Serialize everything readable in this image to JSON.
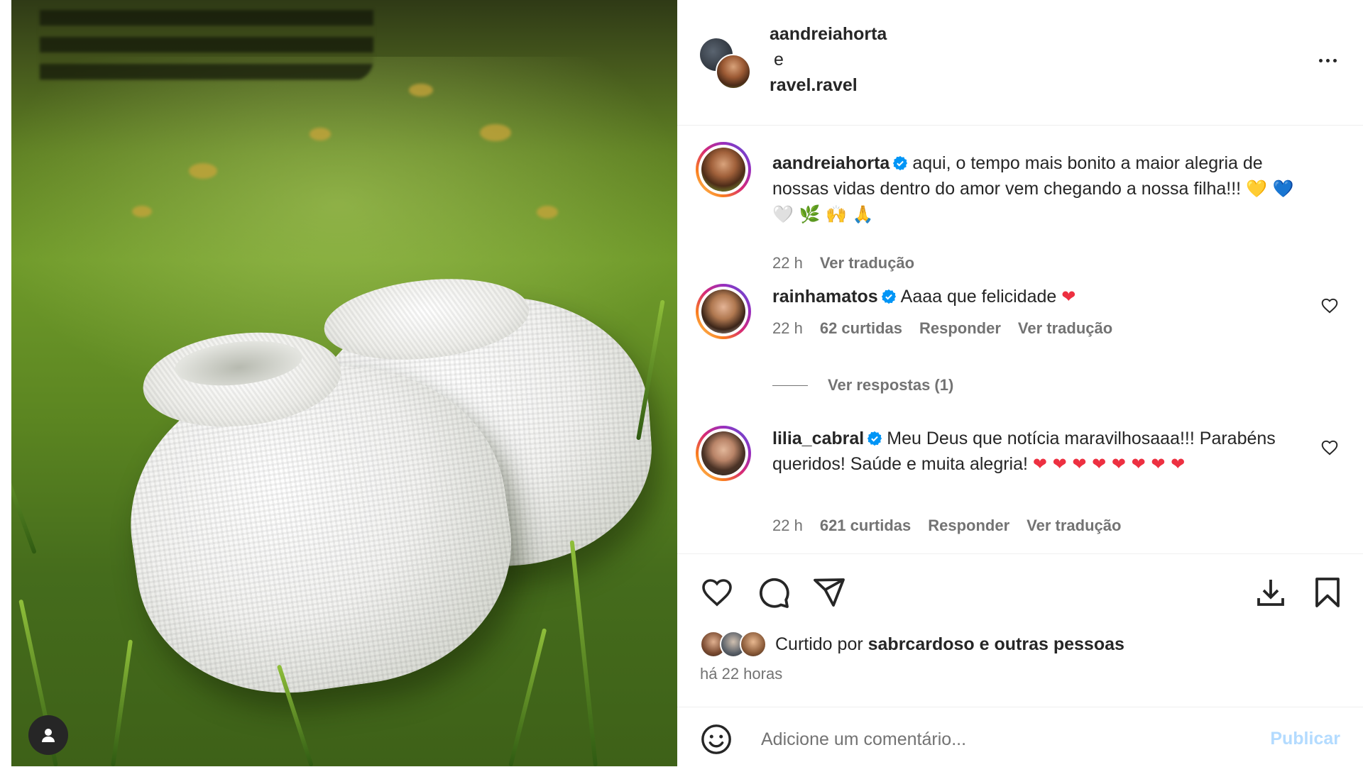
{
  "post": {
    "header": {
      "author1": "aandreiahorta",
      "separator": "e",
      "author2": "ravel.ravel"
    },
    "caption": {
      "username": "aandreiahorta",
      "text": "aqui, o tempo mais bonito a maior alegria de nossas vidas dentro do amor vem chegando a nossa filha!!!",
      "emojis": "💛 💙 🤍 🌿 🙌 🙏",
      "time": "22 h",
      "translate": "Ver tradução"
    },
    "comments": [
      {
        "username": "rainhamatos",
        "text": "Aaaa que felicidade",
        "emojis": "❤",
        "time": "22 h",
        "likes": "62 curtidas",
        "reply": "Responder",
        "translate": "Ver tradução",
        "view_replies": "Ver respostas (1)"
      },
      {
        "username": "lilia_cabral",
        "text": "Meu Deus que notícia maravilhosaaa!!! Parabéns queridos! Saúde e muita alegria!",
        "emojis": "❤ ❤ ❤ ❤ ❤ ❤ ❤ ❤",
        "time": "22 h",
        "likes": "621 curtidas",
        "reply": "Responder",
        "translate": "Ver tradução"
      }
    ],
    "likes": {
      "prefix": "Curtido por",
      "user": "sabrcardoso",
      "connector": "e",
      "others": "outras pessoas"
    },
    "time_ago": "há 22 horas",
    "add_comment": {
      "placeholder": "Adicione um comentário...",
      "publish": "Publicar"
    }
  },
  "colors": {
    "verified": "#0095f6",
    "heart_red": "#ed3041",
    "publish_disabled": "#b3dbff",
    "secondary_text": "#737373"
  },
  "icons": [
    "more-icon",
    "verified-icon",
    "heart-icon",
    "comment-icon",
    "share-icon",
    "download-icon",
    "bookmark-icon",
    "emoji-icon",
    "user-tag-icon"
  ]
}
